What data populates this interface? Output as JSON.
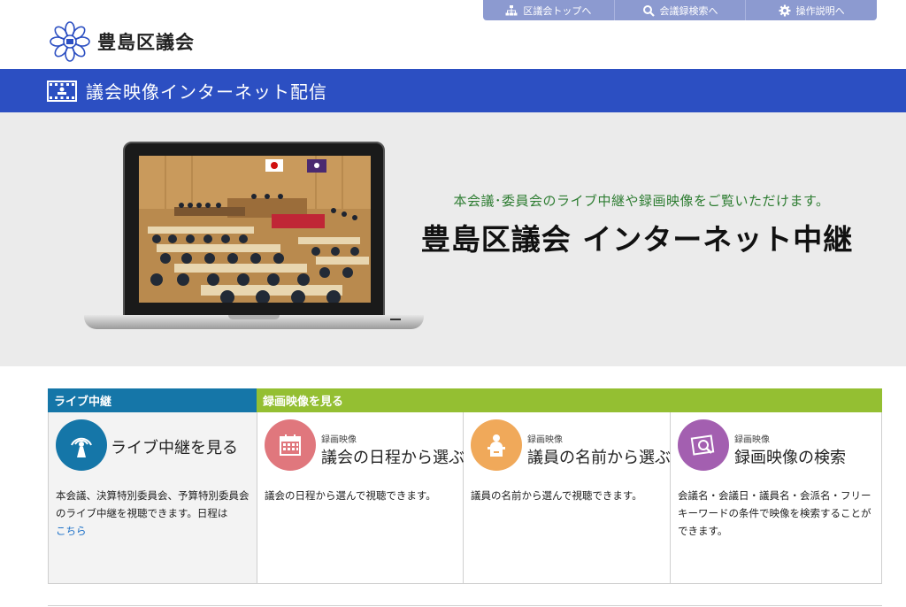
{
  "header": {
    "logo_text": "豊島区議会",
    "nav": [
      {
        "label": "区議会トップへ",
        "icon": "sitemap-icon"
      },
      {
        "label": "会議録検索へ",
        "icon": "search-icon"
      },
      {
        "label": "操作説明へ",
        "icon": "gear-icon"
      }
    ]
  },
  "band": {
    "title": "議会映像インターネット配信",
    "icon": "film-icon"
  },
  "hero": {
    "subtitle": "本会議･委員会のライブ中継や録画映像をご覧いただけます。",
    "title": "豊島区議会 インターネット中継"
  },
  "tabs": {
    "live": "ライブ中継",
    "recorded": "録画映像を見る"
  },
  "cards": {
    "live": {
      "title": "ライブ中継を見る",
      "desc": "本会議、決算特別委員会、予算特別委員会のライブ中継を視聴できます。日程は",
      "link": "こちら",
      "icon": "broadcast-icon",
      "color": "#1576a8"
    },
    "schedule": {
      "small": "録画映像",
      "title": "議会の日程から選ぶ",
      "desc": "議会の日程から選んで視聴できます。",
      "icon": "calendar-icon",
      "color": "#e0777d"
    },
    "member": {
      "small": "録画映像",
      "title": "議員の名前から選ぶ",
      "desc": "議員の名前から選んで視聴できます。",
      "icon": "speaker-podium-icon",
      "color": "#f0a95a"
    },
    "search": {
      "small": "録画映像",
      "title": "録画映像の検索",
      "desc": "会議名・会議日・議員名・会派名・フリーキーワードの条件で映像を検索することができます。",
      "icon": "photo-search-icon",
      "color": "#a35fb0"
    }
  },
  "colors": {
    "band": "#2c4fc2",
    "nav": "#8c9ad0",
    "live_tab": "#1576a8",
    "recorded_tab": "#94bf32",
    "hero_bg": "#ebebeb"
  }
}
